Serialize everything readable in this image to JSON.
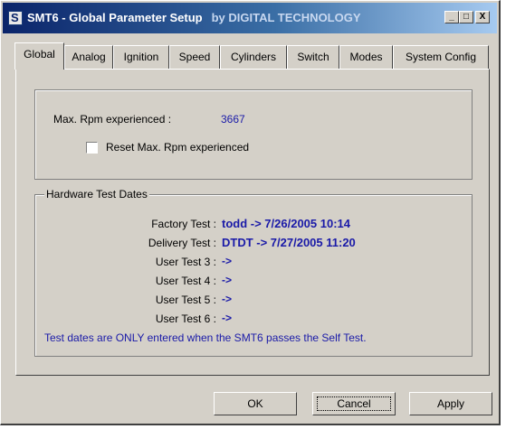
{
  "window": {
    "title": "SMT6 - Global Parameter Setup",
    "title_suffix": "by DIGITAL TECHNOLOGY",
    "controls": [
      "_",
      "□",
      "X"
    ]
  },
  "tabs": [
    "Global",
    "Analog",
    "Ignition",
    "Speed",
    "Cylinders",
    "Switch",
    "Modes",
    "System Config"
  ],
  "active_tab": "Global",
  "rpm": {
    "label": "Max. Rpm experienced :",
    "value": "3667",
    "reset_label": "Reset Max. Rpm experienced",
    "reset_checked": false
  },
  "hardware": {
    "group_label": "Hardware Test Dates",
    "tests": [
      {
        "label": "Factory Test :",
        "value": "todd -> 7/26/2005 10:14"
      },
      {
        "label": "Delivery Test :",
        "value": "DTDT -> 7/27/2005 11:20"
      },
      {
        "label": "User Test 3 :",
        "value": "->"
      },
      {
        "label": "User Test 4 :",
        "value": "->"
      },
      {
        "label": "User Test 5 :",
        "value": "->"
      },
      {
        "label": "User Test 6 :",
        "value": "->"
      }
    ],
    "note": "Test dates are ONLY entered when the SMT6 passes the Self Test."
  },
  "buttons": {
    "ok": "OK",
    "cancel": "Cancel",
    "apply": "Apply"
  }
}
